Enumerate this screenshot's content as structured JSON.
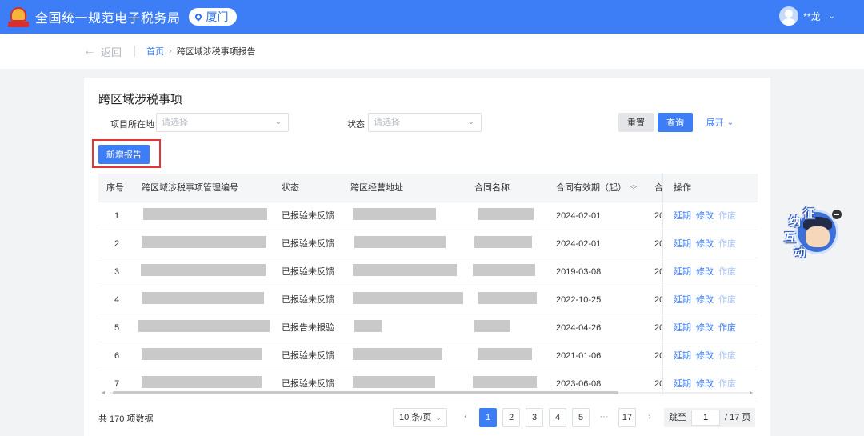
{
  "header": {
    "site_title": "全国统一规范电子税务局",
    "city": "厦门",
    "user_name": "**龙"
  },
  "breadcrumb": {
    "back": "返回",
    "home": "首页",
    "current": "跨区域涉税事项报告"
  },
  "page": {
    "title": "跨区域涉税事项",
    "filters": {
      "location_label": "项目所在地",
      "location_placeholder": "请选择",
      "status_label": "状态",
      "status_placeholder": "请选择"
    },
    "buttons": {
      "reset": "重置",
      "query": "查询",
      "expand": "展开",
      "new_report": "新增报告"
    }
  },
  "table": {
    "columns": [
      "序号",
      "跨区域涉税事项管理编号",
      "状态",
      "跨区经营地址",
      "合同名称",
      "合同有效期（起）",
      "合",
      "操作"
    ],
    "actions": [
      "延期",
      "修改",
      "作废"
    ],
    "rows": [
      {
        "seq": "1",
        "status": "已报验未反馈",
        "date": "2024-02-01",
        "col7": "20",
        "void_enabled": false
      },
      {
        "seq": "2",
        "status": "已报验未反馈",
        "date": "2024-02-01",
        "col7": "20",
        "void_enabled": false
      },
      {
        "seq": "3",
        "status": "已报验未反馈",
        "date": "2019-03-08",
        "col7": "20",
        "void_enabled": false
      },
      {
        "seq": "4",
        "status": "已报验未反馈",
        "date": "2022-10-25",
        "col7": "20",
        "void_enabled": false
      },
      {
        "seq": "5",
        "status": "已报告未报验",
        "date": "2024-04-26",
        "col7": "20",
        "void_enabled": true
      },
      {
        "seq": "6",
        "status": "已报验未反馈",
        "date": "2021-01-06",
        "col7": "20",
        "void_enabled": false
      },
      {
        "seq": "7",
        "status": "已报验未反馈",
        "date": "2023-06-08",
        "col7": "20",
        "void_enabled": false
      }
    ]
  },
  "pagination": {
    "total": "共 170 项数据",
    "page_size": "10 条/页",
    "pages": [
      "1",
      "2",
      "3",
      "4",
      "5",
      "···",
      "17"
    ],
    "current_page": "1",
    "jump_label": "跳至",
    "jump_value": "1",
    "total_pages": "/ 17 页"
  },
  "widget": {
    "chars": [
      "征",
      "纳",
      "互",
      "动"
    ]
  },
  "colors": {
    "primary": "#3d7df5",
    "highlight_border": "#e23535"
  }
}
